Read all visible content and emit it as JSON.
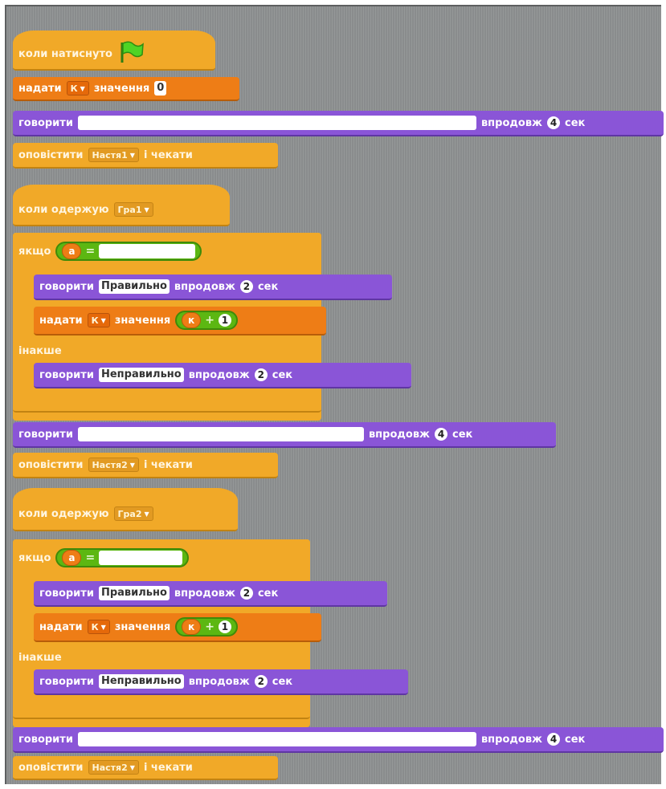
{
  "script1": {
    "hat_label": "коли натиснуто",
    "set_label": "надати",
    "set_var": "К",
    "set_mid": "значення",
    "set_value": "0",
    "say_label": "говорити",
    "say_text": "",
    "say_for": "впродовж",
    "say_secs": "4",
    "say_unit": "сек",
    "broadcast_label": "оповістити",
    "broadcast_msg": "Настя1",
    "broadcast_wait": "і чекати"
  },
  "script2": {
    "hat_label": "коли одержую",
    "hat_msg": "Гра1",
    "if_label": "якщо",
    "cond_var": "а",
    "cond_op": "=",
    "cond_value": "",
    "say1_label": "говорити",
    "say1_text": "Правильно",
    "say1_for": "впродовж",
    "say1_secs": "2",
    "say1_unit": "сек",
    "set_label": "надати",
    "set_var": "К",
    "set_mid": "значення",
    "add_var": "к",
    "add_op": "+",
    "add_value": "1",
    "else_label": "інакше",
    "say2_label": "говорити",
    "say2_text": "Неправильно",
    "say2_for": "впродовж",
    "say2_secs": "2",
    "say2_unit": "сек",
    "say3_label": "говорити",
    "say3_text": "",
    "say3_for": "впродовж",
    "say3_secs": "4",
    "say3_unit": "сек",
    "broadcast_label": "оповістити",
    "broadcast_msg": "Настя2",
    "broadcast_wait": "і чекати"
  },
  "script3": {
    "hat_label": "коли одержую",
    "hat_msg": "Гра2",
    "if_label": "якщо",
    "cond_var": "а",
    "cond_op": "=",
    "cond_value": "",
    "say1_label": "говорити",
    "say1_text": "Правильно",
    "say1_for": "впродовж",
    "say1_secs": "2",
    "say1_unit": "сек",
    "set_label": "надати",
    "set_var": "К",
    "set_mid": "значення",
    "add_var": "к",
    "add_op": "+",
    "add_value": "1",
    "else_label": "інакше",
    "say2_label": "говорити",
    "say2_text": "Неправильно",
    "say2_for": "впродовж",
    "say2_secs": "2",
    "say2_unit": "сек",
    "say3_label": "говорити",
    "say3_text": "",
    "say3_for": "впродовж",
    "say3_secs": "4",
    "say3_unit": "сек",
    "broadcast_label": "оповістити",
    "broadcast_msg": "Настя2",
    "broadcast_wait": "і чекати"
  },
  "icons": {
    "hat_flag": "green-flag-icon",
    "dropdown": "dropdown-triangle-icon"
  },
  "colors": {
    "events": "#f1a928",
    "data": "#ee7d16",
    "looks": "#8a55d7",
    "operators": "#5cb712",
    "canvas": "#8f9293"
  }
}
